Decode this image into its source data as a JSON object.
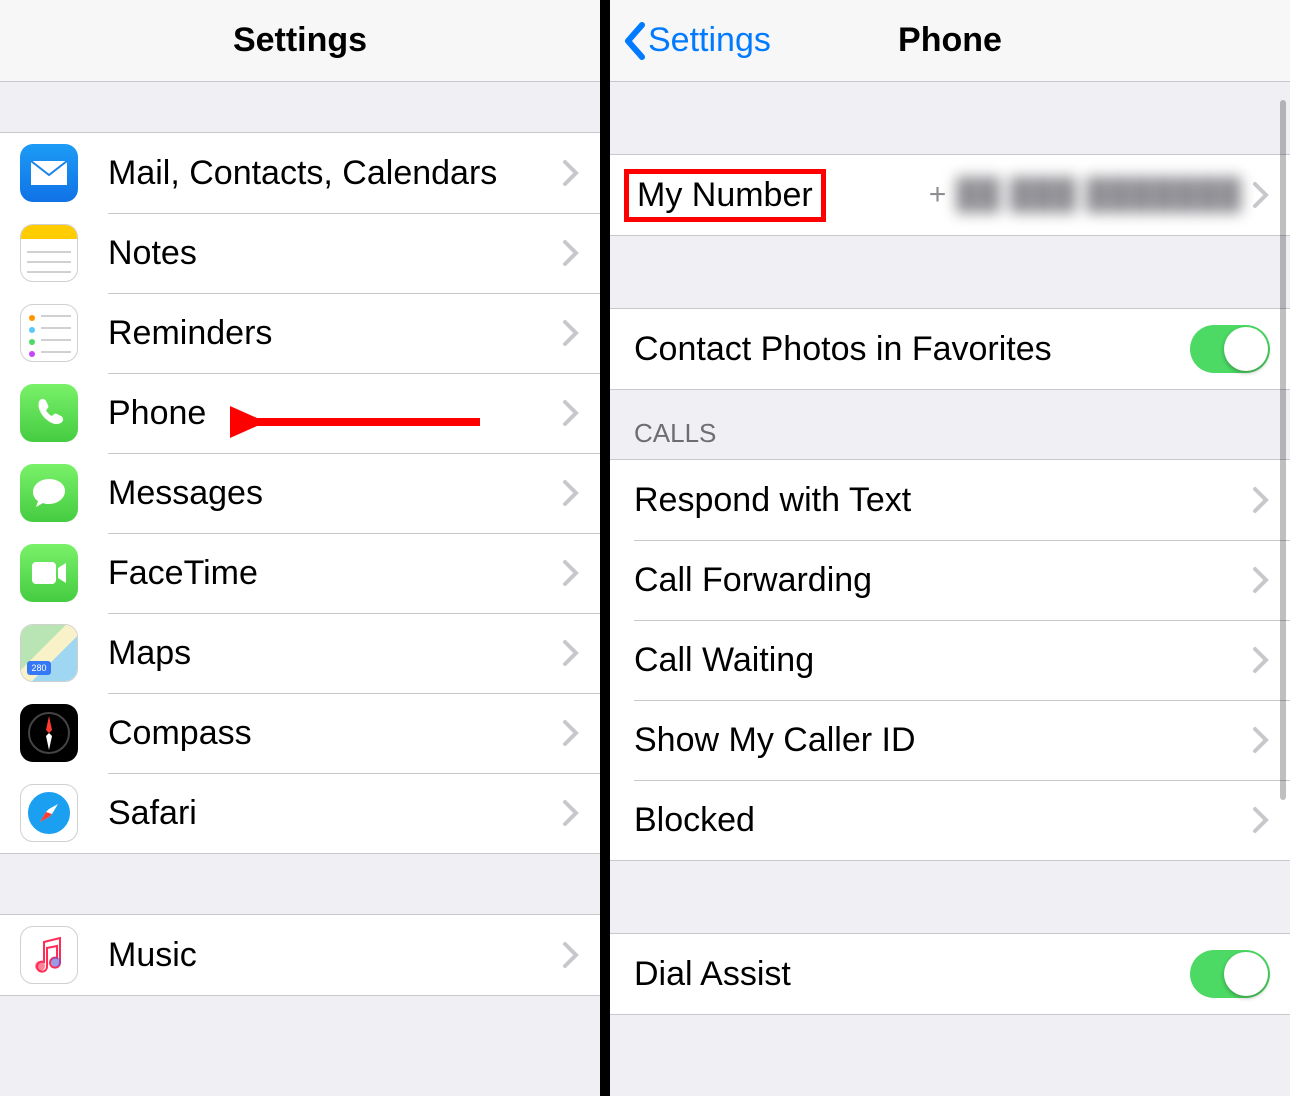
{
  "left": {
    "title": "Settings",
    "items": [
      {
        "label": "Mail, Contacts, Calendars",
        "icon": "mail"
      },
      {
        "label": "Notes",
        "icon": "notes"
      },
      {
        "label": "Reminders",
        "icon": "reminders"
      },
      {
        "label": "Phone",
        "icon": "phone"
      },
      {
        "label": "Messages",
        "icon": "messages"
      },
      {
        "label": "FaceTime",
        "icon": "facetime"
      },
      {
        "label": "Maps",
        "icon": "maps"
      },
      {
        "label": "Compass",
        "icon": "compass"
      },
      {
        "label": "Safari",
        "icon": "safari"
      }
    ],
    "items2": [
      {
        "label": "Music",
        "icon": "music"
      }
    ]
  },
  "right": {
    "back_label": "Settings",
    "title": "Phone",
    "my_number_label": "My Number",
    "my_number_prefix": "+",
    "my_number_value": "██ ███ ███████",
    "contact_photos_label": "Contact Photos in Favorites",
    "calls_header": "CALLS",
    "calls_items": [
      {
        "label": "Respond with Text"
      },
      {
        "label": "Call Forwarding"
      },
      {
        "label": "Call Waiting"
      },
      {
        "label": "Show My Caller ID"
      },
      {
        "label": "Blocked"
      }
    ],
    "dial_assist_label": "Dial Assist"
  }
}
